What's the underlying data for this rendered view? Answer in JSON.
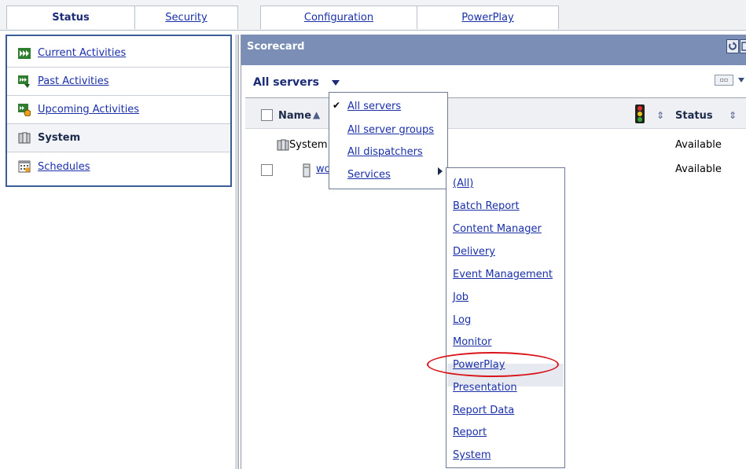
{
  "tabs": [
    {
      "label": "Status",
      "active": true
    },
    {
      "label": "Security",
      "active": false
    },
    {
      "label": "Configuration",
      "active": false
    },
    {
      "label": "PowerPlay",
      "active": false
    }
  ],
  "nav": {
    "items": [
      {
        "label": "Current Activities",
        "icon": "current-activities-icon"
      },
      {
        "label": "Past Activities",
        "icon": "past-activities-icon"
      },
      {
        "label": "Upcoming Activities",
        "icon": "upcoming-activities-icon"
      },
      {
        "label": "System",
        "icon": "system-icon",
        "selected": true
      },
      {
        "label": "Schedules",
        "icon": "schedules-icon"
      }
    ]
  },
  "scorecard": {
    "title": "Scorecard",
    "filter_label": "All servers",
    "columns": {
      "name": "Name",
      "status": "Status"
    },
    "rows": [
      {
        "name": "System",
        "status": "Available"
      },
      {
        "name": "wo",
        "status": "Available"
      }
    ]
  },
  "filter_menu": {
    "items": [
      "All servers",
      "All server groups",
      "All dispatchers",
      "Services"
    ],
    "checked": "All servers"
  },
  "services_menu": {
    "items": [
      "(All)",
      "Batch Report",
      "Content Manager",
      "Delivery",
      "Event Management",
      "Job",
      "Log",
      "Monitor",
      "PowerPlay",
      "Presentation",
      "Report Data",
      "Report",
      "System"
    ],
    "highlighted": "PowerPlay"
  },
  "colors": {
    "accent": "#7b8fb6",
    "nav_border": "#3c5c98",
    "link": "#1a2fa8",
    "annotation": "#d9141b"
  }
}
